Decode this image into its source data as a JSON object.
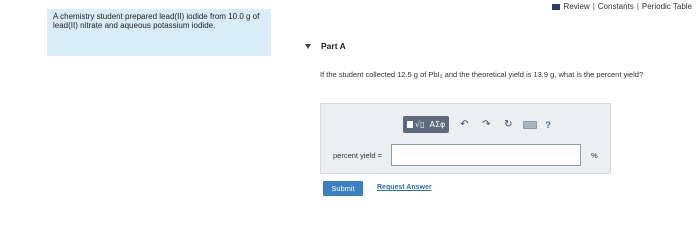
{
  "header": {
    "links": [
      "Review",
      "Constants",
      "Periodic Table"
    ],
    "separator": "|"
  },
  "problem": {
    "text": "A chemistry student prepared lead(II) iodide from 10.0 g of lead(II) nitrate and aqueous potassium iodide."
  },
  "part": {
    "title": "Part A"
  },
  "question": {
    "text": "If the student collected 12.5 g of PbI₂ and the theoretical yield is 13.9 g, what is the percent yield?"
  },
  "toolbar": {
    "templates_label": "√▯",
    "greek_label": "ΑΣφ",
    "help_label": "?"
  },
  "answer": {
    "label": "percent yield =",
    "value": "",
    "unit": "%"
  },
  "actions": {
    "submit_label": "Submit",
    "request_label": "Request Answer"
  }
}
